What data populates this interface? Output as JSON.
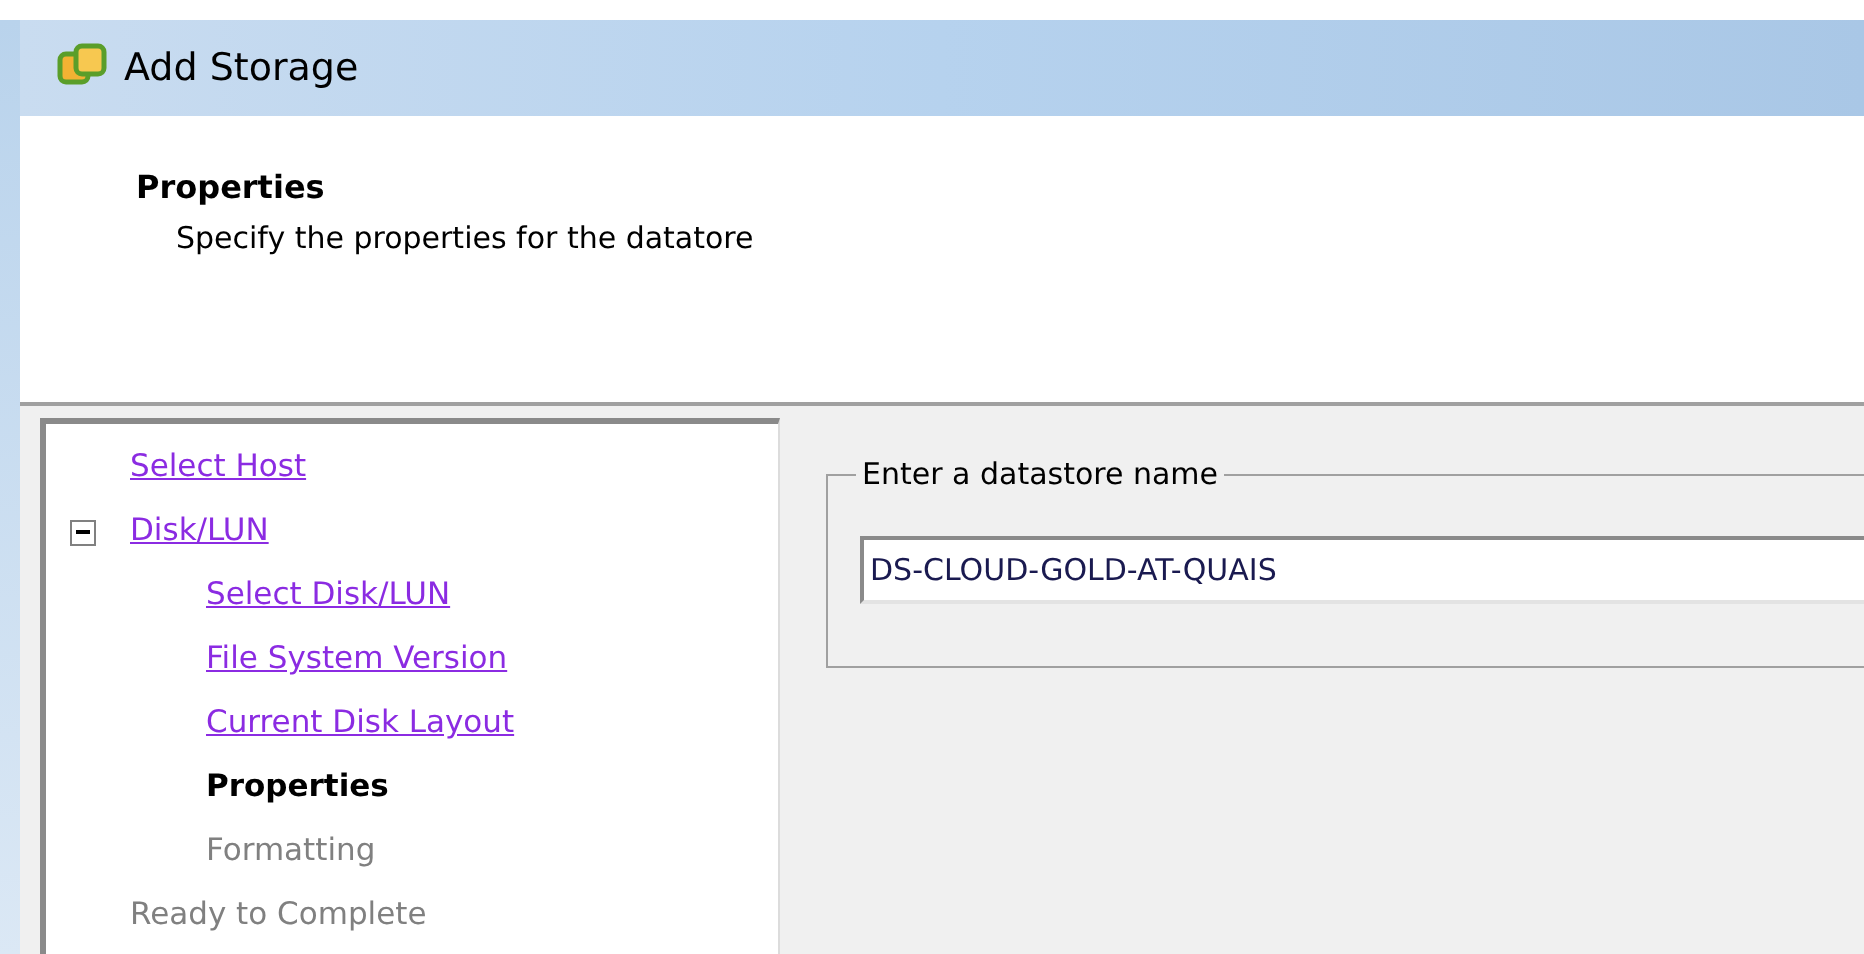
{
  "window": {
    "title": "Add Storage"
  },
  "header": {
    "title": "Properties",
    "subtitle": "Specify the properties for the datatore"
  },
  "steps": [
    {
      "label": "Select Host",
      "kind": "done"
    },
    {
      "label": "Disk/LUN",
      "kind": "done",
      "expanded": true,
      "children": [
        {
          "label": "Select Disk/LUN",
          "kind": "done"
        },
        {
          "label": "File System Version",
          "kind": "done"
        },
        {
          "label": "Current Disk Layout",
          "kind": "done"
        },
        {
          "label": "Properties",
          "kind": "current"
        },
        {
          "label": "Formatting",
          "kind": "pending"
        }
      ]
    },
    {
      "label": "Ready to Complete",
      "kind": "pending"
    }
  ],
  "name_group": {
    "legend": "Enter a datastore name",
    "value": "DS-CLOUD-GOLD-AT-QUAIS"
  }
}
